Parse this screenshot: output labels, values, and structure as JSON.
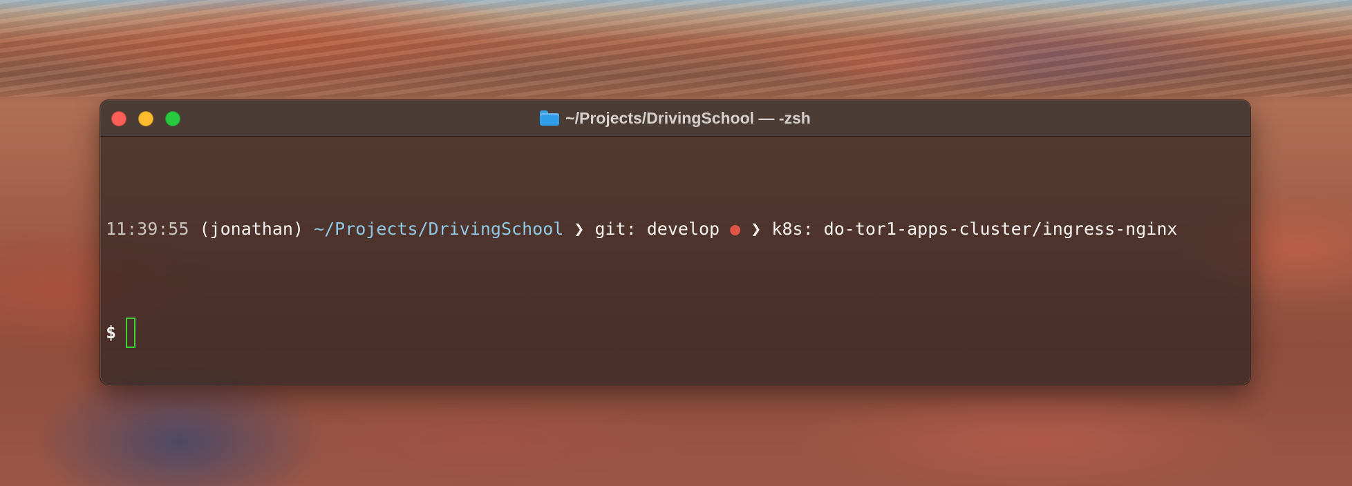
{
  "window": {
    "title": "~/Projects/DrivingSchool — -zsh",
    "folder_icon": "folder-icon"
  },
  "colors": {
    "close": "#ff5f57",
    "minimize": "#febc2e",
    "zoom": "#28c840",
    "path": "#8fc9e6",
    "git_dirty_dot": "#e0554a",
    "cursor": "#3fd23a"
  },
  "prompt": {
    "time": "11:39:55",
    "user": "(jonathan)",
    "path": "~/Projects/DrivingSchool",
    "separator": "❯",
    "git_label": "git: develop",
    "git_status_dot": "●",
    "k8s_label": "k8s: do-tor1-apps-cluster/ingress-nginx",
    "symbol": "$"
  }
}
